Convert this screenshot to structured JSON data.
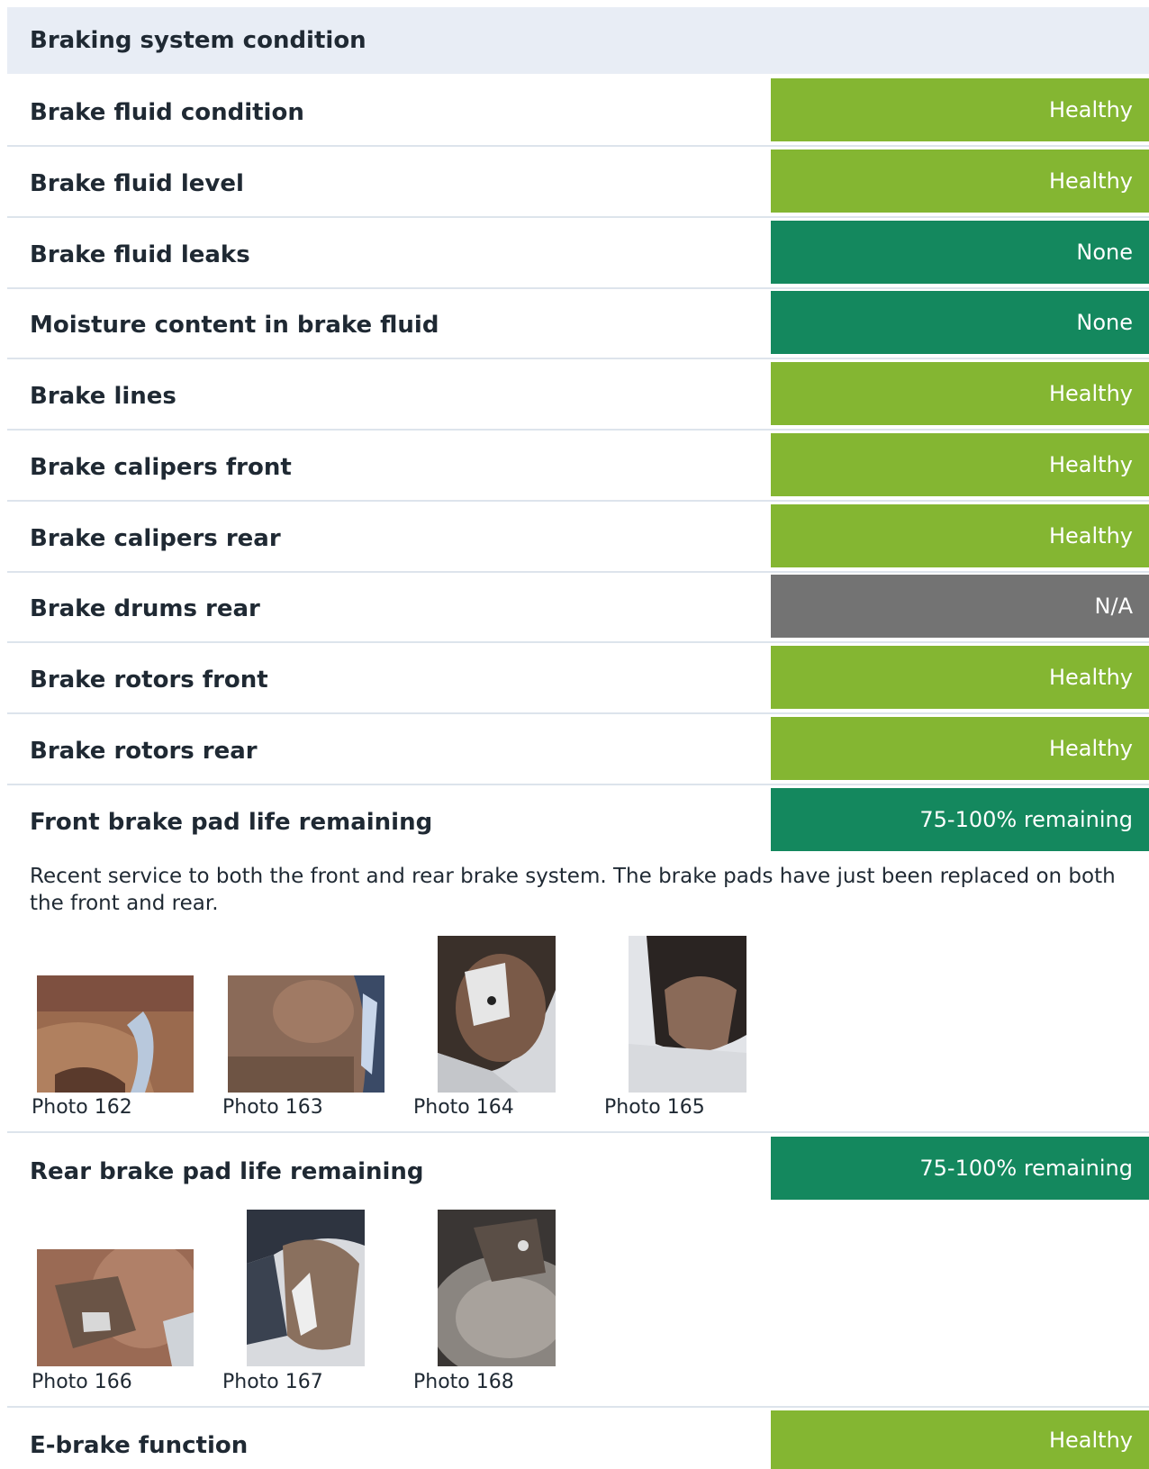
{
  "section": {
    "title": "Braking system condition"
  },
  "colors": {
    "healthy": "#84b632",
    "none": "#14885e",
    "na": "#737373",
    "remaining": "#14885e",
    "header_bg": "#e8edf5"
  },
  "rows": [
    {
      "label": "Brake fluid condition",
      "status": "Healthy"
    },
    {
      "label": "Brake fluid level",
      "status": "Healthy"
    },
    {
      "label": "Brake fluid leaks",
      "status": "None"
    },
    {
      "label": "Moisture content in brake fluid",
      "status": "None"
    },
    {
      "label": "Brake lines",
      "status": "Healthy"
    },
    {
      "label": "Brake calipers front",
      "status": "Healthy"
    },
    {
      "label": "Brake calipers rear",
      "status": "Healthy"
    },
    {
      "label": "Brake drums rear",
      "status": "N/A"
    },
    {
      "label": "Brake rotors front",
      "status": "Healthy"
    },
    {
      "label": "Brake rotors rear",
      "status": "Healthy"
    },
    {
      "label": "Front brake pad life remaining",
      "status": "75-100% remaining"
    },
    {
      "label": "Rear brake pad life remaining",
      "status": "75-100% remaining"
    },
    {
      "label": "E-brake function",
      "status": "Healthy"
    }
  ],
  "front_pad_note": "Recent service to both the front and rear brake system. The brake pads have just been replaced on both the front and rear.",
  "front_photos": [
    "Photo 162",
    "Photo 163",
    "Photo 164",
    "Photo 165"
  ],
  "rear_photos": [
    "Photo 166",
    "Photo 167",
    "Photo 168"
  ]
}
